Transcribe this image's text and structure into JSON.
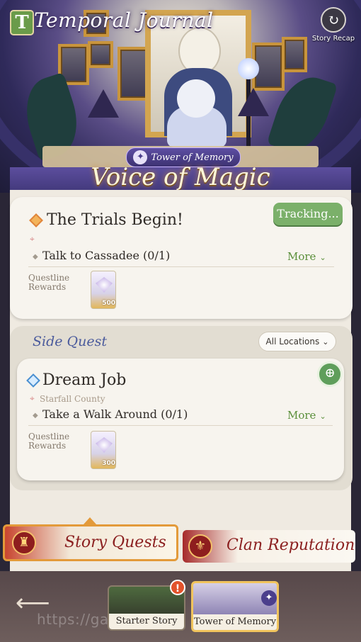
{
  "header": {
    "title": "Temporal Journal",
    "journal_icon_letter": "T",
    "recap_label": "Story Recap",
    "chapter_subtitle": "Tower of Memory",
    "chapter_title": "Voice of Magic"
  },
  "main_quest": {
    "title": "The Trials Begin!",
    "tracking_label": "Tracking...",
    "task": "Talk to Cassadee (0/1)",
    "more_label": "More",
    "rewards_label_1": "Questline",
    "rewards_label_2": "Rewards",
    "reward_count": "500",
    "icon_color": "#e0843a"
  },
  "side_section": {
    "label": "Side Quest",
    "filter_label": "All Locations",
    "quest": {
      "title": "Dream Job",
      "location": "Starfall County",
      "task": "Take a Walk Around (0/1)",
      "more_label": "More",
      "rewards_label_1": "Questline",
      "rewards_label_2": "Rewards",
      "reward_count": "300",
      "icon_color": "#4a8fd0"
    }
  },
  "tabs": {
    "story": "Story Quests",
    "clan": "Clan Reputation"
  },
  "chapters": {
    "starter": "Starter Story",
    "tower": "Tower of Memory",
    "alert": "!"
  },
  "watermark": "https://gam                              eNews"
}
